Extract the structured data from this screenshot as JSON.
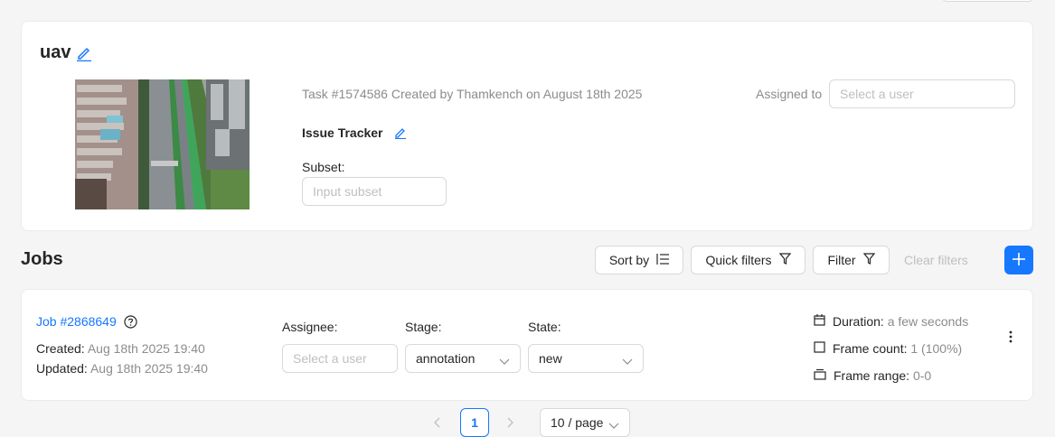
{
  "task": {
    "name": "uav",
    "meta_text": "Task #1574586 Created by Thamkench on August 18th 2025",
    "assigned_label": "Assigned to",
    "assignee_placeholder": "Select a user",
    "issue_tracker_label": "Issue Tracker",
    "subset_label": "Subset:",
    "subset_placeholder": "Input subset"
  },
  "jobs_section": {
    "heading": "Jobs",
    "sort_label": "Sort by",
    "quick_filters_label": "Quick filters",
    "filter_label": "Filter",
    "clear_filters_label": "Clear filters"
  },
  "job": {
    "link": "Job #2868649",
    "created_label": "Created:",
    "created_value": "Aug 18th 2025 19:40",
    "updated_label": "Updated:",
    "updated_value": "Aug 18th 2025 19:40",
    "assignee_label": "Assignee:",
    "assignee_placeholder": "Select a user",
    "stage_label": "Stage:",
    "stage_value": "annotation",
    "state_label": "State:",
    "state_value": "new",
    "duration_label": "Duration:",
    "duration_value": "a few seconds",
    "frame_count_label": "Frame count:",
    "frame_count_value": "1 (100%)",
    "frame_range_label": "Frame range:",
    "frame_range_value": "0-0"
  },
  "pagination": {
    "current_page": "1",
    "page_size": "10 / page"
  },
  "colors": {
    "accent": "#1677ff",
    "muted_text": "#8c8c8c",
    "placeholder": "#bfbfbf",
    "background": "#f5f5f5"
  },
  "icons": [
    "edit-icon",
    "help-icon",
    "sort-icon",
    "filter-icon",
    "plus-icon",
    "calendar-icon",
    "square-icon",
    "frames-icon",
    "more-vertical-icon",
    "chevron-down-icon",
    "chevron-left-icon",
    "chevron-right-icon"
  ]
}
